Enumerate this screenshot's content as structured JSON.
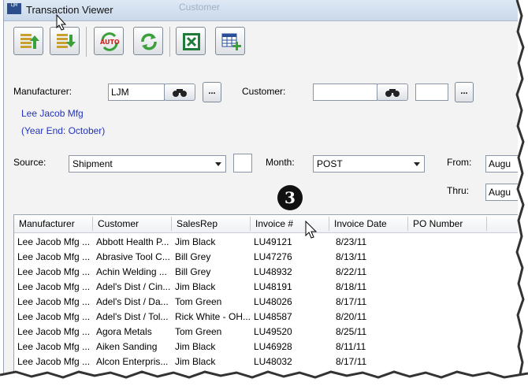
{
  "window": {
    "title": "Transaction Viewer",
    "app_icon_text": "LJM",
    "ghost_text": "Customer"
  },
  "toolbar": {
    "buttons": [
      {
        "name": "import-up"
      },
      {
        "name": "import-down"
      },
      {
        "name": "auto-refresh",
        "label": "AUTO"
      },
      {
        "name": "refresh"
      },
      {
        "name": "excel"
      },
      {
        "name": "add-grid"
      }
    ]
  },
  "form": {
    "manufacturer_label": "Manufacturer:",
    "manufacturer_value": "LJM",
    "manufacturer_name": "Lee Jacob Mfg",
    "year_end": "(Year End: October)",
    "customer_label": "Customer:",
    "customer_value": "",
    "ellipsis": "...",
    "source_label": "Source:",
    "source_value": "Shipment",
    "month_label": "Month:",
    "month_value": "POST",
    "from_label": "From:",
    "from_value": "Augu",
    "thru_label": "Thru:",
    "thru_value": "Augu"
  },
  "callout": "3",
  "grid": {
    "columns": [
      "Manufacturer",
      "Customer",
      "SalesRep",
      "Invoice #",
      "Invoice Date",
      "PO Number"
    ],
    "rows": [
      [
        "Lee Jacob Mfg ...",
        "Abbott Health P...",
        "Jim Black",
        "LU49121",
        "8/23/11",
        ""
      ],
      [
        "Lee Jacob Mfg ...",
        "Abrasive Tool C...",
        "Bill Grey",
        "LU47276",
        "8/13/11",
        ""
      ],
      [
        "Lee Jacob Mfg ...",
        "Achin Welding ...",
        "Bill Grey",
        "LU48932",
        "8/22/11",
        ""
      ],
      [
        "Lee Jacob Mfg ...",
        "Adel's Dist / Cin...",
        "Jim Black",
        "LU48191",
        "8/18/11",
        ""
      ],
      [
        "Lee Jacob Mfg ...",
        "Adel's Dist / Da...",
        "Tom Green",
        "LU48026",
        "8/17/11",
        ""
      ],
      [
        "Lee Jacob Mfg ...",
        "Adel's Dist / Tol...",
        "Rick White - OH...",
        "LU48587",
        "8/20/11",
        ""
      ],
      [
        "Lee Jacob Mfg ...",
        "Agora Metals",
        "Tom Green",
        "LU49520",
        "8/25/11",
        ""
      ],
      [
        "Lee Jacob Mfg ...",
        "Aiken Sanding",
        "Jim Black",
        "LU46928",
        "8/11/11",
        ""
      ],
      [
        "Lee Jacob Mfg ...",
        "Alcon Enterpris...",
        "Jim Black",
        "LU48032",
        "8/17/11",
        ""
      ]
    ]
  },
  "colors": {
    "link_blue": "#2233bb",
    "title_bg": "#c9d8ea"
  }
}
